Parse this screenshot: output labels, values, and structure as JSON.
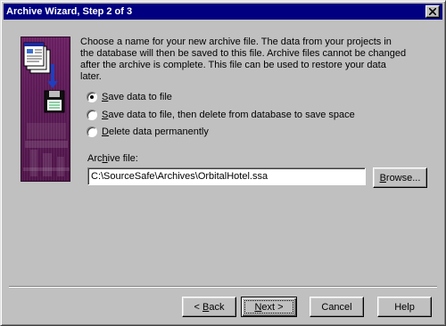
{
  "window": {
    "title": "Archive Wizard, Step 2 of 3"
  },
  "description": "Choose a name for your new archive file.  The data from your projects in\nthe database will then be saved to this file.  Archive files cannot be changed\nafter the archive is complete.  This file can be used to restore your data\nlater.",
  "options": [
    {
      "prefix": "",
      "accel": "S",
      "rest": "ave data to file",
      "selected": true
    },
    {
      "prefix": "",
      "accel": "S",
      "rest": "ave data to file, then delete from database to save space",
      "selected": false
    },
    {
      "prefix": "",
      "accel": "D",
      "rest": "elete data permanently",
      "selected": false
    }
  ],
  "archive_file": {
    "label_prefix": "Arc",
    "label_accel": "h",
    "label_rest": "ive file:",
    "value": "C:\\SourceSafe\\Archives\\OrbitalHotel.ssa"
  },
  "browse": {
    "prefix": "",
    "accel": "B",
    "rest": "rowse..."
  },
  "buttons": {
    "back": {
      "prefix": "< ",
      "accel": "B",
      "rest": "ack"
    },
    "next": {
      "prefix": "",
      "accel": "N",
      "rest": "ext >"
    },
    "cancel": "Cancel",
    "help": "Help"
  },
  "colors": {
    "title_bar": "#000080",
    "dialog_face": "#c0c0c0",
    "wizard_art": "#5b1a55"
  },
  "icons": {
    "close": "close-icon",
    "wizard_art": "archive-wizard-illustration"
  }
}
